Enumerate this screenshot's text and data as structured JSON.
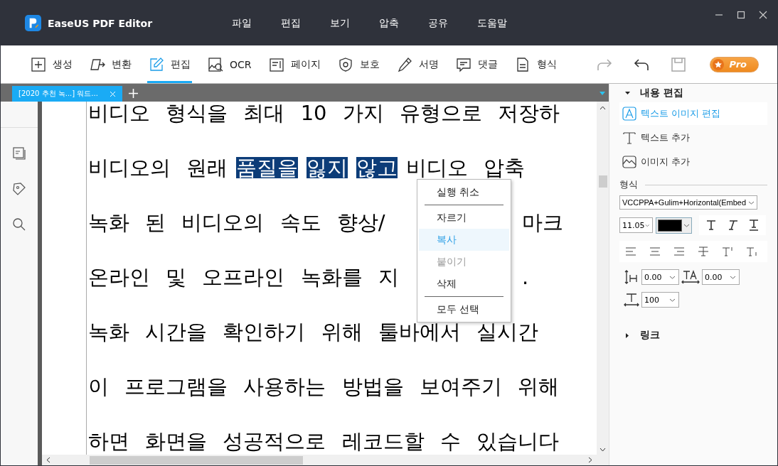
{
  "window": {
    "title": "EaseUS PDF Editor"
  },
  "menu": [
    "파일",
    "편집",
    "보기",
    "압축",
    "공유",
    "도움말"
  ],
  "toolbar": [
    {
      "label": "생성",
      "kind": "create",
      "selected": false
    },
    {
      "label": "변환",
      "kind": "convert",
      "selected": false
    },
    {
      "label": "편집",
      "kind": "edit",
      "selected": true
    },
    {
      "label": "OCR",
      "kind": "ocr",
      "selected": false
    },
    {
      "label": "페이지",
      "kind": "page",
      "selected": false
    },
    {
      "label": "보호",
      "kind": "protect",
      "selected": false
    },
    {
      "label": "서명",
      "kind": "sign",
      "selected": false
    },
    {
      "label": "댓글",
      "kind": "comment",
      "selected": false
    },
    {
      "label": "형식",
      "kind": "form",
      "selected": false
    }
  ],
  "quick_actions": [
    {
      "kind": "redo",
      "disabled": true
    },
    {
      "kind": "undo",
      "disabled": false
    },
    {
      "kind": "save",
      "disabled": true
    }
  ],
  "pro_badge": {
    "label": "Pro"
  },
  "document_tab": {
    "title": "[2020 추천 녹...] 워드..."
  },
  "document": {
    "lines": [
      {
        "parts": [
          {
            "text": "비디오 형식을 최대 10 가지 유형으로 저장하",
            "selected": false
          }
        ]
      },
      {
        "parts": [
          {
            "text": "비디오의 원래",
            "selected": false
          },
          {
            "text": "품질을",
            "selected": true
          },
          {
            "text": "잃지",
            "selected": true
          },
          {
            "text": "않고",
            "selected": true
          },
          {
            "text": "비디오 압축",
            "selected": false
          }
        ]
      },
      {
        "parts": [
          {
            "text": "녹화 된 비디오의 속도 향상/",
            "selected": false
          }
        ],
        "tail": "마크"
      },
      {
        "parts": [
          {
            "text": "온라인 및 오프라인 녹화를 지",
            "selected": false
          }
        ],
        "tail": "."
      },
      {
        "parts": [
          {
            "text": "녹화 시간을 확인하기 위해 툴바에서 실시간",
            "selected": false
          }
        ]
      },
      {
        "parts": [
          {
            "text": "이 프로그램을 사용하는 방법을 보여주기 위해",
            "selected": false
          }
        ]
      },
      {
        "parts": [
          {
            "text": "하면 화면을 성공적으로 레코드할 수 있습니다",
            "selected": false
          }
        ]
      }
    ]
  },
  "context_menu": {
    "items": [
      {
        "kind": "item",
        "label": "실행 취소",
        "selected": false,
        "disabled": false
      },
      {
        "kind": "separator"
      },
      {
        "kind": "item",
        "label": "자르기",
        "selected": false,
        "disabled": false
      },
      {
        "kind": "item",
        "label": "복사",
        "selected": true,
        "disabled": false
      },
      {
        "kind": "item",
        "label": "붙이기",
        "selected": false,
        "disabled": true
      },
      {
        "kind": "item",
        "label": "삭제",
        "selected": false,
        "disabled": false
      },
      {
        "kind": "separator"
      },
      {
        "kind": "item",
        "label": "모두 선택",
        "selected": false,
        "disabled": false
      }
    ]
  },
  "properties": {
    "content_edit": {
      "title": "내용 편집",
      "expanded": true,
      "items": [
        {
          "label": "텍스트 이미지 편집",
          "kind": "edit",
          "selected": true
        },
        {
          "label": "텍스트 추가",
          "kind": "text",
          "selected": false
        },
        {
          "label": "이미지 추가",
          "kind": "image",
          "selected": false
        }
      ]
    },
    "format": {
      "title": "형식",
      "font": "VCCPPA+Gulim+Horizontal(Embed",
      "size": "11.05",
      "color": "#000000",
      "line_spacing": "0.00",
      "char_spacing": "0.00",
      "scale": "100"
    },
    "link": {
      "title": "링크",
      "expanded": false
    }
  }
}
